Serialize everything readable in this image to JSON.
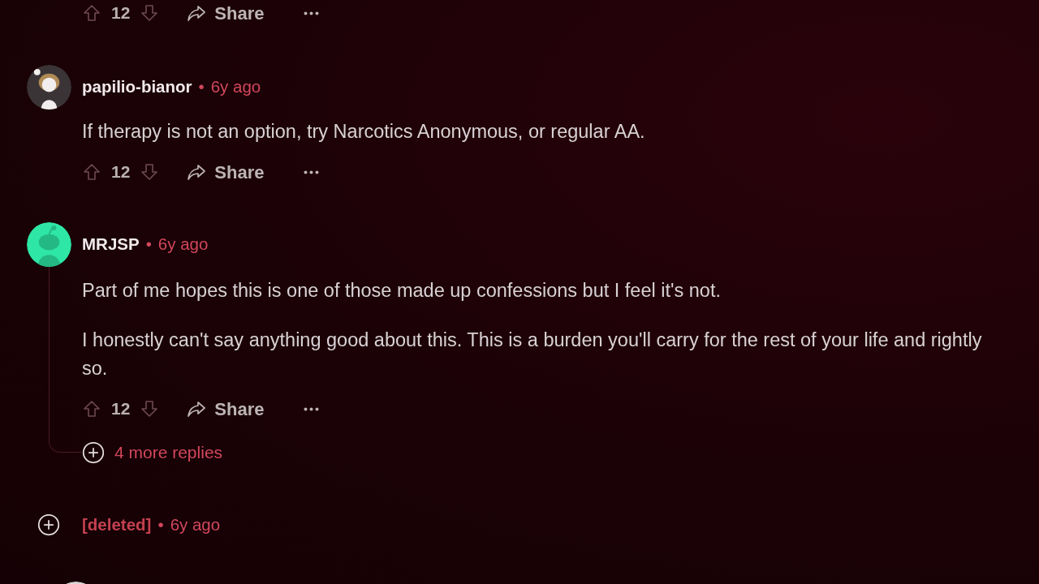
{
  "top_actions": {
    "votes": "12",
    "share": "Share"
  },
  "comments": [
    {
      "kind": "full",
      "author": "papilio-bianor",
      "dot": "•",
      "time": "6y ago",
      "avatar": {
        "kind": "figure",
        "color": "#3a3436"
      },
      "paragraphs": [
        "If therapy is not an option, try Narcotics Anonymous, or regular AA."
      ],
      "votes": "12",
      "share": "Share"
    },
    {
      "kind": "full",
      "author": "MRJSP",
      "dot": "•",
      "time": "6y ago",
      "avatar": {
        "kind": "silhouette",
        "color": "#2ee6a6"
      },
      "paragraphs": [
        "Part of me hopes this is one of those made up confessions but I feel it's not.",
        "I honestly can't say anything good about this. This is a burden you'll carry for the rest of your life and rightly so."
      ],
      "votes": "12",
      "share": "Share",
      "more_replies": "4 more replies"
    },
    {
      "kind": "collapsed",
      "author": "[deleted]",
      "dot": "•",
      "time": "6y ago"
    }
  ]
}
